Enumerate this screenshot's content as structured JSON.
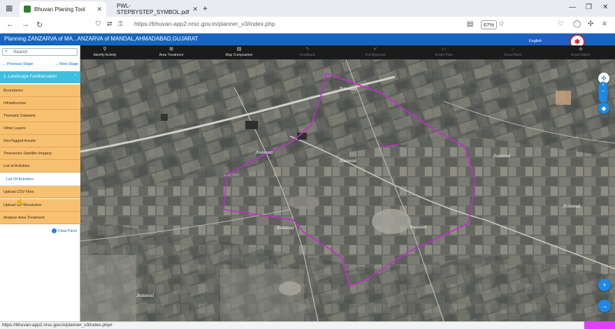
{
  "browser": {
    "tabs": [
      {
        "label": "Bhuvan Planing Tool",
        "active": true,
        "fav_color": "#2e7d32"
      },
      {
        "label": "PWL-STEPBYSTEP_SYMBOL.pdf",
        "active": false,
        "fav_color": "#c62828"
      }
    ],
    "new_tab": "+",
    "url": "https://bhuvan-app2.nrsc.gov.in/planner_v3/index.php",
    "zoom": "67%"
  },
  "app": {
    "title": "Planning ZANZARVA of MA...ANZARVA of MANDAL,AHMADABAD,GUJARAT",
    "language": "English",
    "accent": "#1565c0"
  },
  "toolbar": [
    {
      "label": "Identify Activity",
      "icon": "map-pin-icon",
      "glyph": "⚲",
      "enabled": true
    },
    {
      "label": "Area Treatment",
      "icon": "plus-box-icon",
      "glyph": "⊞",
      "enabled": true
    },
    {
      "label": "Map Composition",
      "icon": "map-icon",
      "glyph": "▤",
      "enabled": true
    },
    {
      "label": "Feedback",
      "icon": "edit-icon",
      "glyph": "✎",
      "enabled": false
    },
    {
      "label": "2nd Approval",
      "icon": "check-circle-icon",
      "glyph": "✔",
      "enabled": false
    },
    {
      "label": "Action Plan",
      "icon": "print-icon",
      "glyph": "▭",
      "enabled": false
    },
    {
      "label": "Asset Bank",
      "icon": "bank-icon",
      "glyph": "⌂",
      "enabled": false
    },
    {
      "label": "Asset Watch",
      "icon": "eye-icon",
      "glyph": "◉",
      "enabled": false
    }
  ],
  "sidebar": {
    "search_placeholder": "Search",
    "previous_stage": "Previous Stage",
    "next_stage": "Next Stage",
    "stage_header": "1. Landscape Familiarization",
    "items": [
      {
        "label": "Boundaries",
        "type": "main"
      },
      {
        "label": "Infrastructure",
        "type": "main"
      },
      {
        "label": "Thematic Datasets",
        "type": "main"
      },
      {
        "label": "Other Layers",
        "type": "main"
      },
      {
        "label": "GeoTagged Assets",
        "type": "main"
      },
      {
        "label": "Timeseries Satellite Imagery",
        "type": "main"
      },
      {
        "label": "List of Activities",
        "type": "main"
      },
      {
        "label": "List Of Activities",
        "type": "sub"
      },
      {
        "label": "Upload CSV Files",
        "type": "main"
      },
      {
        "label": "Upload GP Resolution",
        "type": "main"
      },
      {
        "label": "Analyse Area Treatment",
        "type": "main"
      }
    ],
    "close_panel": "Close Panel",
    "item_color": "#f7c071",
    "header_color": "#3dbfe0"
  },
  "map": {
    "boundary_color": "#c62ad1",
    "village_labels": [
      "Jhalawad",
      "Jhalawad",
      "Jhalawad",
      "Jhalawad",
      "Jhalawad",
      "Jhalawad",
      "Jhalawad",
      "Jhalawad"
    ]
  },
  "status": {
    "text": "https://bhuvan-app2.nrsc.gov.in/planner_v3/index.php#"
  }
}
